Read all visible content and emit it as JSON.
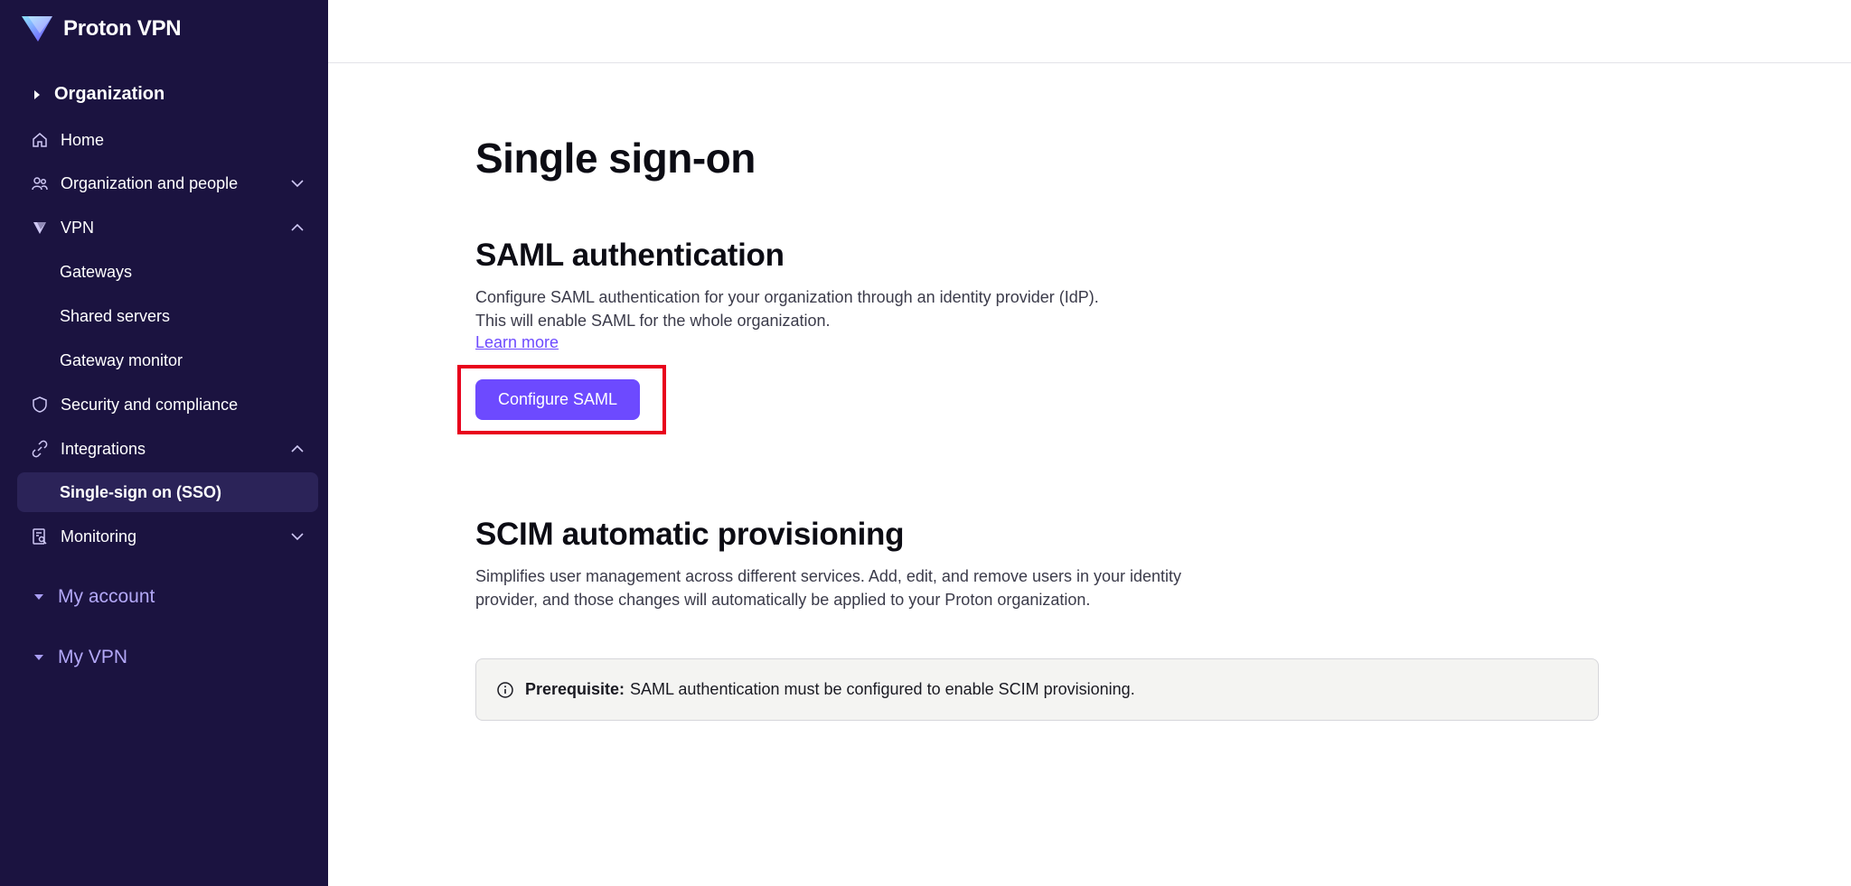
{
  "brand": {
    "name": "Proton VPN"
  },
  "sidebar": {
    "organization_label": "Organization",
    "items": [
      {
        "label": "Home",
        "icon": "home-icon"
      },
      {
        "label": "Organization and people",
        "icon": "people-icon",
        "expand": "chevron-down"
      },
      {
        "label": "VPN",
        "icon": "vpn-icon",
        "expand": "chevron-up"
      },
      {
        "label": "Gateways"
      },
      {
        "label": "Shared servers"
      },
      {
        "label": "Gateway monitor"
      },
      {
        "label": "Security and compliance",
        "icon": "shield-icon"
      },
      {
        "label": "Integrations",
        "icon": "link-icon",
        "expand": "chevron-up"
      },
      {
        "label": "Single-sign on (SSO)",
        "active": true
      },
      {
        "label": "Monitoring",
        "icon": "monitoring-icon",
        "expand": "chevron-down"
      }
    ],
    "my_account_label": "My account",
    "my_vpn_label": "My VPN"
  },
  "main": {
    "title": "Single sign-on",
    "saml": {
      "heading": "SAML authentication",
      "description_line1": "Configure SAML authentication for your organization through an identity provider (IdP).",
      "description_line2": "This will enable SAML for the whole organization.",
      "learn_more": "Learn more",
      "button_label": "Configure SAML"
    },
    "scim": {
      "heading": "SCIM automatic provisioning",
      "description": "Simplifies user management across different services. Add, edit, and remove users in your identity provider, and those changes will automatically be applied to your Proton organization.",
      "notice_label": "Prerequisite:",
      "notice_text": "SAML authentication must be configured to enable SCIM provisioning."
    }
  },
  "colors": {
    "sidebar_bg": "#1b1340",
    "accent": "#6d4aff",
    "highlight": "#e8001c"
  }
}
